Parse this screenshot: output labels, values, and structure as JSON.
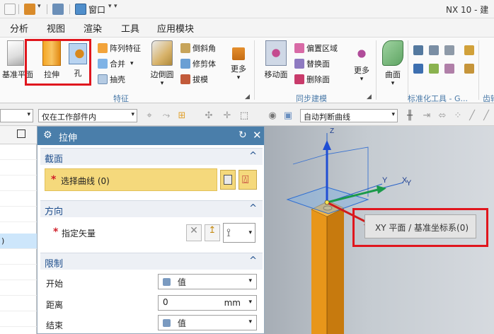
{
  "titlebar": {
    "window_label": "窗口",
    "app_title": "NX 10 - 建",
    "dropdown_glyph": "▾"
  },
  "menubar": {
    "items": [
      "分析",
      "视图",
      "渲染",
      "工具",
      "应用模块"
    ]
  },
  "ribbon": {
    "datum_plane": "基准平面",
    "extrude": "拉伸",
    "hole": "孔",
    "pattern_feature": "阵列特征",
    "unite": "合并",
    "shell": "抽壳",
    "edge_blend": "边倒圆",
    "chamfer": "倒斜角",
    "trim_body": "修剪体",
    "draft": "拔模",
    "more_feature": "更多",
    "feature_group": "特征",
    "move_face": "移动面",
    "offset_region": "偏置区域",
    "replace_face": "替换面",
    "delete_face": "删除面",
    "more_sync": "更多",
    "sync_group": "同步建模",
    "surface": "曲面",
    "std_tools_group": "标准化工具 - G...",
    "gear_group": "齿轮"
  },
  "filterbar": {
    "scope_filter": "仅在工作部件内",
    "curve_rule": "自动判断曲线"
  },
  "nav": {
    "selected_fragment": ")"
  },
  "dialog": {
    "title": "拉伸",
    "section_section": "截面",
    "select_curve": "选择曲线 (0)",
    "section_direction": "方向",
    "specify_vector": "指定矢量",
    "section_limits": "限制",
    "start_label": "开始",
    "start_value": "值",
    "distance_label": "距离",
    "distance_value": "0",
    "distance_unit": "mm",
    "end_label": "结束",
    "end_value": "值",
    "required_mark": "*",
    "collapse_glyph": "^"
  },
  "viewport": {
    "axis_x": "X",
    "axis_y": "Y",
    "axis_z": "Z",
    "axis_y_datum": "Y",
    "axis_x_datum": "X",
    "axis_z_datum": "Z",
    "tooltip": "XY 平面 / 基准坐标系(0)"
  },
  "colors": {
    "accent": "#4a7eaa",
    "highlight_red": "#e0161e",
    "selection_yellow": "#f5d97c",
    "solid_orange": "#f0a11d"
  }
}
